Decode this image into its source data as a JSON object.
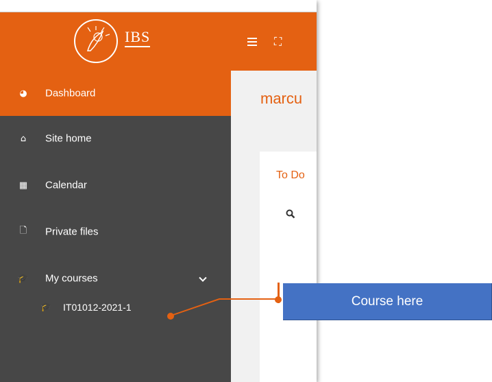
{
  "header": {
    "logo_text": "IBS",
    "menu_icon": "hamburger-icon",
    "fullscreen_icon": "fullscreen-icon",
    "fullscreen_glyph": "⛶"
  },
  "sidebar": {
    "items": [
      {
        "label": "Dashboard",
        "icon": "dashboard-icon",
        "glyph": "◕"
      },
      {
        "label": "Site home",
        "icon": "home-icon",
        "glyph": "⌂"
      },
      {
        "label": "Calendar",
        "icon": "calendar-icon",
        "glyph": "▦"
      },
      {
        "label": "Private files",
        "icon": "file-icon",
        "glyph": "🗋"
      },
      {
        "label": "My courses",
        "icon": "graduation-cap-icon",
        "glyph": "🎓"
      }
    ],
    "sub_items": [
      {
        "label": "IT01012-2021-1",
        "icon": "graduation-cap-icon",
        "glyph": "🎓"
      }
    ]
  },
  "main": {
    "user_name": "marcu",
    "card_title": "To Do"
  },
  "callout": {
    "label": "Course here"
  },
  "colors": {
    "brand": "#e46112",
    "sidebar": "#474747",
    "callout": "#4472c4"
  }
}
